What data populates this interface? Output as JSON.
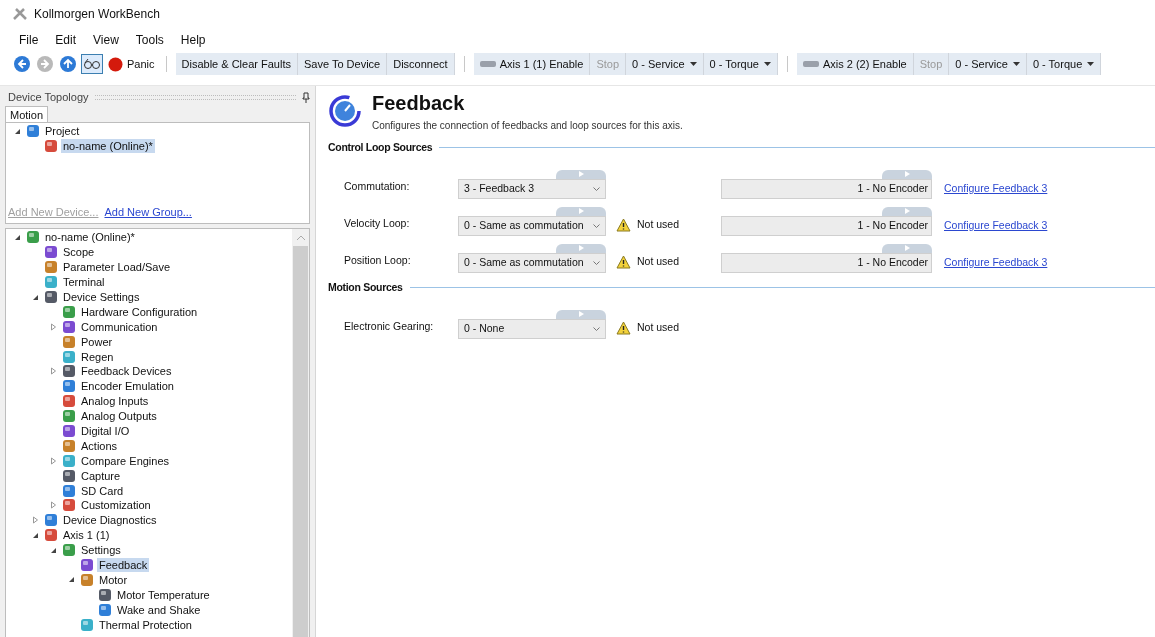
{
  "window": {
    "title": "Kollmorgen WorkBench"
  },
  "menu": [
    "File",
    "Edit",
    "View",
    "Tools",
    "Help"
  ],
  "toolbar": {
    "nav": [
      {
        "kind": "back",
        "disabled": false
      },
      {
        "kind": "forward",
        "disabled": true
      },
      {
        "kind": "up",
        "disabled": false
      },
      {
        "kind": "glasses",
        "checked": true
      }
    ],
    "panic": "Panic",
    "buttons": [
      "Disable & Clear Faults",
      "Save To Device",
      "Disconnect"
    ],
    "axes": [
      {
        "enable": "Axis 1 (1) Enable",
        "stop": "Stop",
        "stop_disabled": true,
        "mode": "0 - Service",
        "control": "0 - Torque"
      },
      {
        "enable": "Axis 2 (2) Enable",
        "stop": "Stop",
        "stop_disabled": true,
        "mode": "0 - Service",
        "control": "0 - Torque"
      }
    ]
  },
  "topology": {
    "title": "Device Topology",
    "tabs": [
      {
        "label": "Motion",
        "selected": true
      }
    ],
    "tree": [
      {
        "label": "Project",
        "expanded": true,
        "selected": false,
        "children": [
          {
            "label": "no-name (Online)*",
            "selected": true
          }
        ]
      }
    ],
    "links": [
      {
        "label": "Add New Device...",
        "disabled": true
      },
      {
        "label": "Add New Group...",
        "disabled": false
      }
    ]
  },
  "device_tree": [
    {
      "label": "no-name (Online)*",
      "expanded": true,
      "selected": false,
      "children": [
        {
          "label": "Scope",
          "selected": false
        },
        {
          "label": "Parameter Load/Save",
          "selected": false
        },
        {
          "label": "Terminal",
          "selected": false
        },
        {
          "label": "Device Settings",
          "expanded": true,
          "selected": false,
          "children": [
            {
              "label": "Hardware Configuration",
              "selected": false
            },
            {
              "label": "Communication",
              "expanded": false,
              "selected": false
            },
            {
              "label": "Power",
              "selected": false
            },
            {
              "label": "Regen",
              "selected": false
            },
            {
              "label": "Feedback Devices",
              "expanded": false,
              "selected": false
            },
            {
              "label": "Encoder Emulation",
              "selected": false
            },
            {
              "label": "Analog Inputs",
              "selected": false
            },
            {
              "label": "Analog Outputs",
              "selected": false
            },
            {
              "label": "Digital I/O",
              "selected": false
            },
            {
              "label": "Actions",
              "selected": false
            },
            {
              "label": "Compare Engines",
              "expanded": false,
              "selected": false
            },
            {
              "label": "Capture",
              "selected": false
            },
            {
              "label": "SD Card",
              "selected": false
            },
            {
              "label": "Customization",
              "expanded": false,
              "selected": false
            }
          ]
        },
        {
          "label": "Device Diagnostics",
          "expanded": false,
          "selected": false
        },
        {
          "label": "Axis 1 (1)",
          "expanded": true,
          "selected": false,
          "children": [
            {
              "label": "Settings",
              "expanded": true,
              "selected": false,
              "children": [
                {
                  "label": "Feedback",
                  "selected": true
                },
                {
                  "label": "Motor",
                  "expanded": true,
                  "selected": false,
                  "children": [
                    {
                      "label": "Motor Temperature",
                      "selected": false
                    },
                    {
                      "label": "Wake and Shake",
                      "selected": false
                    }
                  ]
                },
                {
                  "label": "Thermal Protection",
                  "selected": false
                }
              ]
            }
          ]
        }
      ]
    }
  ],
  "page": {
    "title": "Feedback",
    "description": "Configures the connection of feedbacks and loop sources for this axis.",
    "sections": [
      {
        "title": "Control Loop Sources",
        "rows": [
          {
            "label": "Commutation:",
            "value": "3 - Feedback 3",
            "encoder": "1 - No Encoder",
            "link": "Configure Feedback 3"
          },
          {
            "label": "Velocity Loop:",
            "value": "0 - Same as commutation",
            "warning": "Not used",
            "encoder": "1 - No Encoder",
            "link": "Configure Feedback 3"
          },
          {
            "label": "Position Loop:",
            "value": "0 - Same as commutation",
            "warning": "Not used",
            "encoder": "1 - No Encoder",
            "link": "Configure Feedback 3"
          }
        ]
      },
      {
        "title": "Motion Sources",
        "rows": [
          {
            "label": "Electronic Gearing:",
            "value": "0 - None",
            "warning": "Not used"
          }
        ]
      }
    ]
  }
}
